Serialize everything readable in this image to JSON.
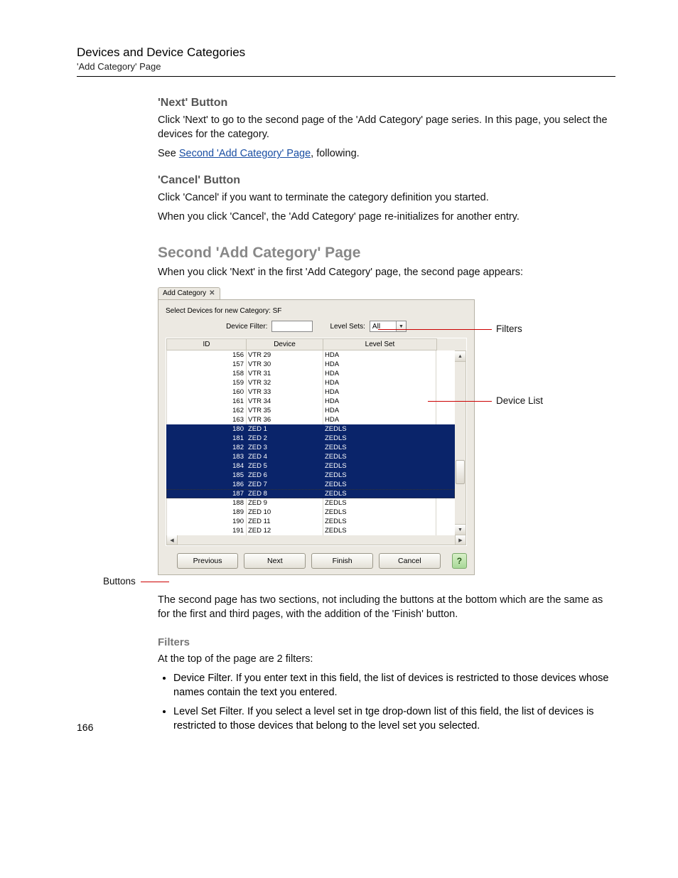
{
  "header": {
    "title": "Devices and Device Categories",
    "subtitle": "'Add Category' Page"
  },
  "sections": {
    "next_btn": {
      "heading": "'Next' Button",
      "p1": "Click 'Next' to go to the second page of the 'Add Category' page series. In this page, you select the devices for the category.",
      "p2_pre": "See ",
      "p2_link": "Second 'Add Category' Page",
      "p2_post": ", following."
    },
    "cancel_btn": {
      "heading": "'Cancel' Button",
      "p1": "Click 'Cancel' if you want to terminate the category definition you started.",
      "p2": "When you click 'Cancel', the 'Add Category' page re-initializes for another entry."
    },
    "second_page": {
      "heading": "Second 'Add Category' Page",
      "intro": "When you click 'Next' in the first 'Add Category' page, the second page appears:",
      "outro": "The second page has two sections, not including the buttons at the bottom which are the same as for the first and third pages, with the addition of the 'Finish' button."
    },
    "filters": {
      "heading": "Filters",
      "intro": "At the top of the page are 2 filters:",
      "b1": "Device Filter. If you enter text in this field, the list of devices is restricted to those devices whose names contain the text you entered.",
      "b2": "Level Set Filter. If you select a level set in tge drop-down list of this field, the list of devices is restricted to those devices that belong to the level set you selected."
    }
  },
  "screenshot": {
    "tab_label": "Add Category",
    "section_label": "Select Devices for new Category: SF",
    "device_filter_label": "Device Filter:",
    "device_filter_value": "",
    "levelsets_label": "Level Sets:",
    "levelsets_value": "All",
    "columns": {
      "id": "ID",
      "device": "Device",
      "levelset": "Level Set"
    },
    "rows": [
      {
        "id": "156",
        "device": "VTR 29",
        "ls": "HDA",
        "sel": false
      },
      {
        "id": "157",
        "device": "VTR 30",
        "ls": "HDA",
        "sel": false
      },
      {
        "id": "158",
        "device": "VTR 31",
        "ls": "HDA",
        "sel": false
      },
      {
        "id": "159",
        "device": "VTR 32",
        "ls": "HDA",
        "sel": false
      },
      {
        "id": "160",
        "device": "VTR 33",
        "ls": "HDA",
        "sel": false
      },
      {
        "id": "161",
        "device": "VTR 34",
        "ls": "HDA",
        "sel": false
      },
      {
        "id": "162",
        "device": "VTR 35",
        "ls": "HDA",
        "sel": false
      },
      {
        "id": "163",
        "device": "VTR 36",
        "ls": "HDA",
        "sel": false
      },
      {
        "id": "180",
        "device": "ZED  1",
        "ls": "ZEDLS",
        "sel": true
      },
      {
        "id": "181",
        "device": "ZED  2",
        "ls": "ZEDLS",
        "sel": true
      },
      {
        "id": "182",
        "device": "ZED  3",
        "ls": "ZEDLS",
        "sel": true
      },
      {
        "id": "183",
        "device": "ZED  4",
        "ls": "ZEDLS",
        "sel": true
      },
      {
        "id": "184",
        "device": "ZED  5",
        "ls": "ZEDLS",
        "sel": true
      },
      {
        "id": "185",
        "device": "ZED  6",
        "ls": "ZEDLS",
        "sel": true
      },
      {
        "id": "186",
        "device": "ZED  7",
        "ls": "ZEDLS",
        "sel": true
      },
      {
        "id": "187",
        "device": "ZED  8",
        "ls": "ZEDLS",
        "sel": true,
        "dash": true
      },
      {
        "id": "188",
        "device": "ZED  9",
        "ls": "ZEDLS",
        "sel": false
      },
      {
        "id": "189",
        "device": "ZED 10",
        "ls": "ZEDLS",
        "sel": false
      },
      {
        "id": "190",
        "device": "ZED 11",
        "ls": "ZEDLS",
        "sel": false
      },
      {
        "id": "191",
        "device": "ZED 12",
        "ls": "ZEDLS",
        "sel": false
      }
    ],
    "buttons": {
      "previous": "Previous",
      "next": "Next",
      "finish": "Finish",
      "cancel": "Cancel"
    },
    "callouts": {
      "filters": "Filters",
      "device_list": "Device List",
      "buttons": "Buttons"
    }
  },
  "page_number": "166"
}
